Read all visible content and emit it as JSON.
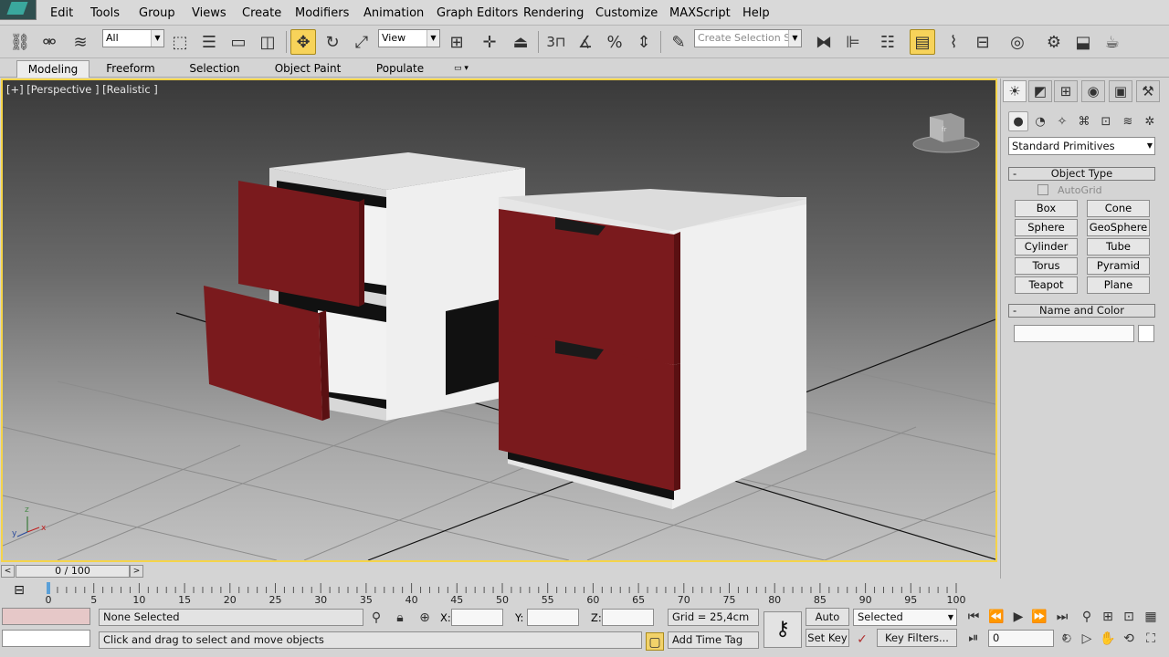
{
  "menu": [
    "Edit",
    "Tools",
    "Group",
    "Views",
    "Create",
    "Modifiers",
    "Animation",
    "Graph Editors",
    "Rendering",
    "Customize",
    "MAXScript",
    "Help"
  ],
  "toolbar": {
    "filter_value": "All",
    "ref_coord_value": "View",
    "angle_snap_label": "3",
    "selection_set_placeholder": "Create Selection Se"
  },
  "ribbon_tabs": [
    "Modeling",
    "Freeform",
    "Selection",
    "Object Paint",
    "Populate"
  ],
  "viewport": {
    "label": "[+] [Perspective ] [Realistic ]",
    "axis_x": "x",
    "axis_y": "y",
    "axis_z": "z",
    "viewcube_text": "fr",
    "colors": {
      "drawer_front": "#7a1a1d",
      "cabinet": "#e6e6e6",
      "active_border": "#f5d44a"
    }
  },
  "command_panel": {
    "primitives_value": "Standard Primitives",
    "object_type_title": "Object Type",
    "autogrid_label": "AutoGrid",
    "object_buttons": [
      "Box",
      "Cone",
      "Sphere",
      "GeoSphere",
      "Cylinder",
      "Tube",
      "Torus",
      "Pyramid",
      "Teapot",
      "Plane"
    ],
    "name_color_title": "Name and Color",
    "name_value": ""
  },
  "time_slider": {
    "label": "0 / 100",
    "current": 0,
    "end": 100
  },
  "trackbar": {
    "ticks": [
      0,
      5,
      10,
      15,
      20,
      25,
      30,
      35,
      40,
      45,
      50,
      55,
      60,
      65,
      70,
      75,
      80,
      85,
      90,
      95,
      100
    ]
  },
  "status": {
    "selection_text": "None Selected",
    "prompt_text": "Click and drag to select and move objects",
    "x_label": "X:",
    "y_label": "Y:",
    "z_label": "Z:",
    "x_value": "",
    "y_value": "",
    "z_value": "",
    "grid_text": "Grid = 25,4cm",
    "add_time_tag": "Add Time Tag",
    "auto_key": "Auto Key",
    "set_key": "Set Key",
    "key_mode_value": "Selected",
    "key_filters": "Key Filters...",
    "frame_value": "0"
  }
}
